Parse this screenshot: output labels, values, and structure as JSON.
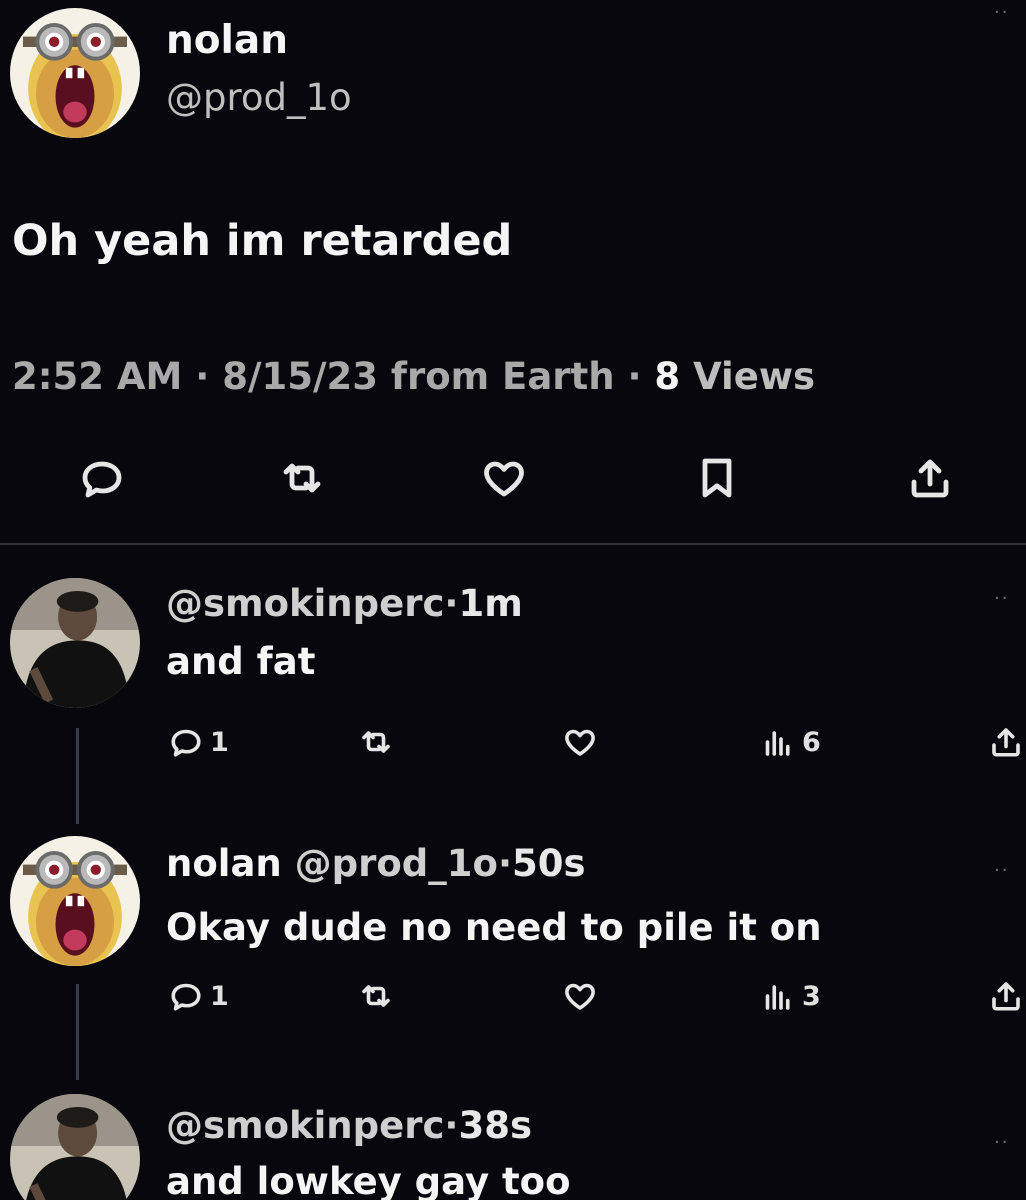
{
  "main_tweet": {
    "name": "nolan",
    "handle": "@prod_1o",
    "text": "Oh yeah im retarded",
    "time": "2:52 AM",
    "date": "8/15/23 from Earth",
    "views_count": "8",
    "views_label": "Views",
    "separator": "·",
    "actions": [
      "reply-icon",
      "retweet-icon",
      "like-icon",
      "bookmark-icon",
      "share-icon"
    ]
  },
  "replies": [
    {
      "name": "",
      "handle": "@smokinperc",
      "time": "1m",
      "text": "and fat",
      "reply_count": "1",
      "views": "6"
    },
    {
      "name": "nolan",
      "handle": "@prod_1o",
      "time": "50s",
      "text": "Okay dude no need to pile it on",
      "reply_count": "1",
      "views": "3"
    },
    {
      "name": "",
      "handle": "@smokinperc",
      "time": "38s",
      "text": "and lowkey gay too"
    }
  ],
  "separator": "·",
  "more_dots": "··",
  "colors": {
    "background": "#07070d",
    "text": "#f5f5f5",
    "muted": "#a9a9a9",
    "divider": "#2f3336"
  }
}
